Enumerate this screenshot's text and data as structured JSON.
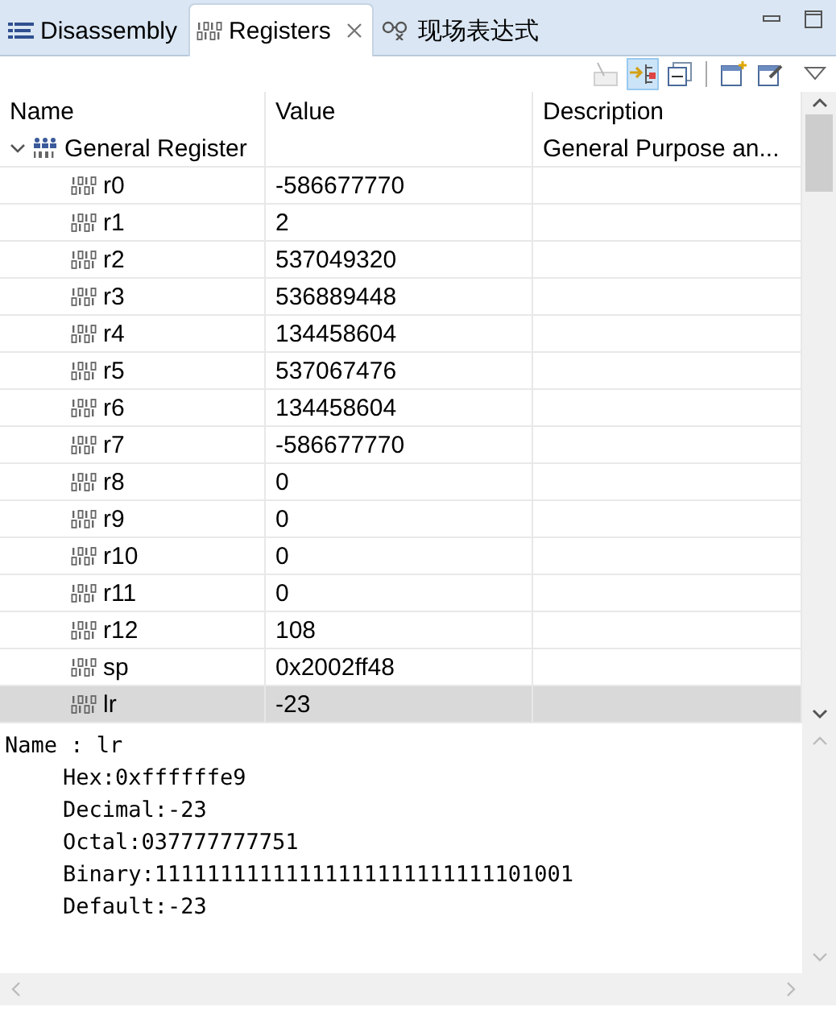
{
  "tabs": [
    {
      "kind": "disassembly",
      "label": "Disassembly",
      "selected": false,
      "closable": false
    },
    {
      "kind": "registers",
      "label": "Registers",
      "selected": true,
      "closable": true
    },
    {
      "kind": "expressions",
      "label": "现场表达式",
      "selected": false,
      "closable": false
    }
  ],
  "toolbar": [
    {
      "kind": "number-format",
      "disabled": true,
      "on": false
    },
    {
      "kind": "layout",
      "disabled": false,
      "on": true
    },
    {
      "kind": "collapse",
      "disabled": false,
      "on": false
    },
    {
      "kind": "new-group",
      "disabled": false,
      "on": false
    },
    {
      "kind": "edit-group",
      "disabled": false,
      "on": false
    }
  ],
  "table": {
    "columns": [
      "Name",
      "Value",
      "Description"
    ],
    "groups": [
      {
        "name": "General Register",
        "description": "General Purpose an...",
        "expanded": true,
        "children": [
          {
            "name": "r0",
            "value": "-586677770",
            "selected": false
          },
          {
            "name": "r1",
            "value": "2",
            "selected": false
          },
          {
            "name": "r2",
            "value": "537049320",
            "selected": false
          },
          {
            "name": "r3",
            "value": "536889448",
            "selected": false
          },
          {
            "name": "r4",
            "value": "134458604",
            "selected": false
          },
          {
            "name": "r5",
            "value": "537067476",
            "selected": false
          },
          {
            "name": "r6",
            "value": "134458604",
            "selected": false
          },
          {
            "name": "r7",
            "value": "-586677770",
            "selected": false
          },
          {
            "name": "r8",
            "value": "0",
            "selected": false
          },
          {
            "name": "r9",
            "value": "0",
            "selected": false
          },
          {
            "name": "r10",
            "value": "0",
            "selected": false
          },
          {
            "name": "r11",
            "value": "0",
            "selected": false
          },
          {
            "name": "r12",
            "value": "108",
            "selected": false
          },
          {
            "name": "sp",
            "value": "0x2002ff48",
            "selected": false
          },
          {
            "name": "lr",
            "value": "-23",
            "selected": true
          }
        ]
      }
    ]
  },
  "details": {
    "lines": [
      "Name : lr",
      "Hex:0xffffffe9",
      "Decimal:-23",
      "Octal:037777777751",
      "Binary:11111111111111111111111111101001",
      "Default:-23"
    ]
  }
}
